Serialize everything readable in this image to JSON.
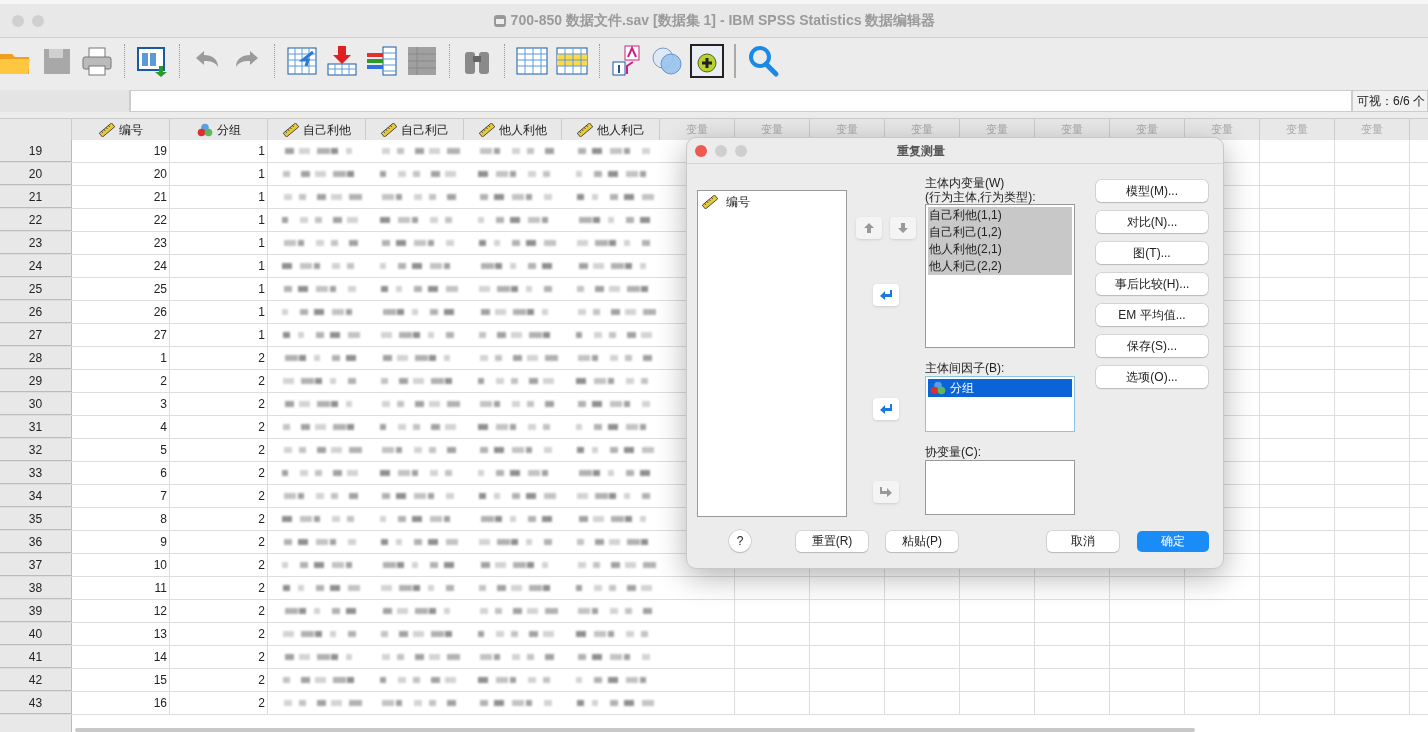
{
  "window": {
    "title": "700-850 数据文件.sav [数据集 1] - IBM SPSS Statistics 数据编辑器"
  },
  "cell_editor": {
    "visible_count": "可视：6/6 个"
  },
  "grid": {
    "columns": [
      {
        "name": "编号",
        "kind": "scale"
      },
      {
        "name": "分组",
        "kind": "nominal"
      },
      {
        "name": "自己利他",
        "kind": "scale"
      },
      {
        "name": "自己利己",
        "kind": "scale"
      },
      {
        "name": "他人利他",
        "kind": "scale"
      },
      {
        "name": "他人利己",
        "kind": "scale"
      }
    ],
    "empty_columns": [
      "变量",
      "变量",
      "变量",
      "变量",
      "变量",
      "变量",
      "变量",
      "变量",
      "变量",
      "变量"
    ],
    "rows": [
      {
        "row": "19",
        "cells": [
          "19",
          "1"
        ]
      },
      {
        "row": "20",
        "cells": [
          "20",
          "1"
        ]
      },
      {
        "row": "21",
        "cells": [
          "21",
          "1"
        ]
      },
      {
        "row": "22",
        "cells": [
          "22",
          "1"
        ]
      },
      {
        "row": "23",
        "cells": [
          "23",
          "1"
        ]
      },
      {
        "row": "24",
        "cells": [
          "24",
          "1"
        ]
      },
      {
        "row": "25",
        "cells": [
          "25",
          "1"
        ]
      },
      {
        "row": "26",
        "cells": [
          "26",
          "1"
        ]
      },
      {
        "row": "27",
        "cells": [
          "27",
          "1"
        ]
      },
      {
        "row": "28",
        "cells": [
          "1",
          "2"
        ]
      },
      {
        "row": "29",
        "cells": [
          "2",
          "2"
        ]
      },
      {
        "row": "30",
        "cells": [
          "3",
          "2"
        ]
      },
      {
        "row": "31",
        "cells": [
          "4",
          "2"
        ]
      },
      {
        "row": "32",
        "cells": [
          "5",
          "2"
        ]
      },
      {
        "row": "33",
        "cells": [
          "6",
          "2"
        ]
      },
      {
        "row": "34",
        "cells": [
          "7",
          "2"
        ]
      },
      {
        "row": "35",
        "cells": [
          "8",
          "2"
        ]
      },
      {
        "row": "36",
        "cells": [
          "9",
          "2"
        ]
      },
      {
        "row": "37",
        "cells": [
          "10",
          "2"
        ]
      },
      {
        "row": "38",
        "cells": [
          "11",
          "2"
        ]
      },
      {
        "row": "39",
        "cells": [
          "12",
          "2"
        ]
      },
      {
        "row": "40",
        "cells": [
          "13",
          "2"
        ]
      },
      {
        "row": "41",
        "cells": [
          "14",
          "2"
        ]
      },
      {
        "row": "42",
        "cells": [
          "15",
          "2"
        ]
      },
      {
        "row": "43",
        "cells": [
          "16",
          "2"
        ]
      }
    ]
  },
  "dialog": {
    "title": "重复测量",
    "source_list": [
      {
        "label": "编号",
        "kind": "scale"
      }
    ],
    "within_label": [
      "主体内变量(W)",
      "(行为主体,行为类型):"
    ],
    "within_items": [
      {
        "label": "自己利他(1,1)",
        "selected": true
      },
      {
        "label": "自己利己(1,2)",
        "selected": true
      },
      {
        "label": "他人利他(2,1)",
        "selected": true
      },
      {
        "label": "他人利己(2,2)",
        "selected": true
      }
    ],
    "between_label": "主体间因子(B):",
    "between_items": [
      {
        "label": "分组",
        "kind": "nominal",
        "selected": true
      }
    ],
    "covariate_label": "协变量(C):",
    "side_buttons": [
      "模型(M)...",
      "对比(N)...",
      "图(T)...",
      "事后比较(H)...",
      "EM 平均值...",
      "保存(S)...",
      "选项(O)..."
    ],
    "bottom_buttons": [
      {
        "label": "?",
        "kind": "help"
      },
      {
        "label": "重置(R)",
        "kind": "normal"
      },
      {
        "label": "粘贴(P)",
        "kind": "normal"
      },
      {
        "label": "取消",
        "kind": "normal"
      },
      {
        "label": "确定",
        "kind": "default"
      }
    ]
  }
}
